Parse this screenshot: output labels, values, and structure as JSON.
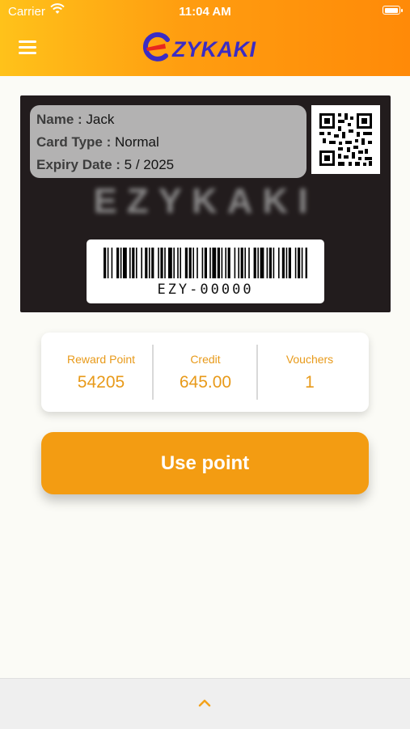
{
  "status_bar": {
    "carrier": "Carrier",
    "time": "11:04 AM",
    "battery_level": 1.0
  },
  "header": {
    "logo_text": "ZYKAKI",
    "brand_color": "#3b2cc4",
    "accent_colors": [
      "#ffc21a",
      "#ff8a08"
    ]
  },
  "card": {
    "name_label": "Name :",
    "name_value": "Jack",
    "type_label": "Card Type :",
    "type_value": "Normal",
    "expiry_label": "Expiry Date :",
    "expiry_value": "5 / 2025",
    "watermark": "EZYKAKI",
    "barcode_number": "EZY-00000"
  },
  "stats": [
    {
      "label": "Reward Point",
      "value": "54205"
    },
    {
      "label": "Credit",
      "value": "645.00"
    },
    {
      "label": "Vouchers",
      "value": "1"
    }
  ],
  "actions": {
    "use_point_label": "Use point",
    "button_color": "#f39c12"
  },
  "icons": [
    "wifi-icon",
    "battery-icon",
    "menu-icon",
    "qr-code-icon",
    "barcode-icon",
    "chevron-up-icon"
  ]
}
